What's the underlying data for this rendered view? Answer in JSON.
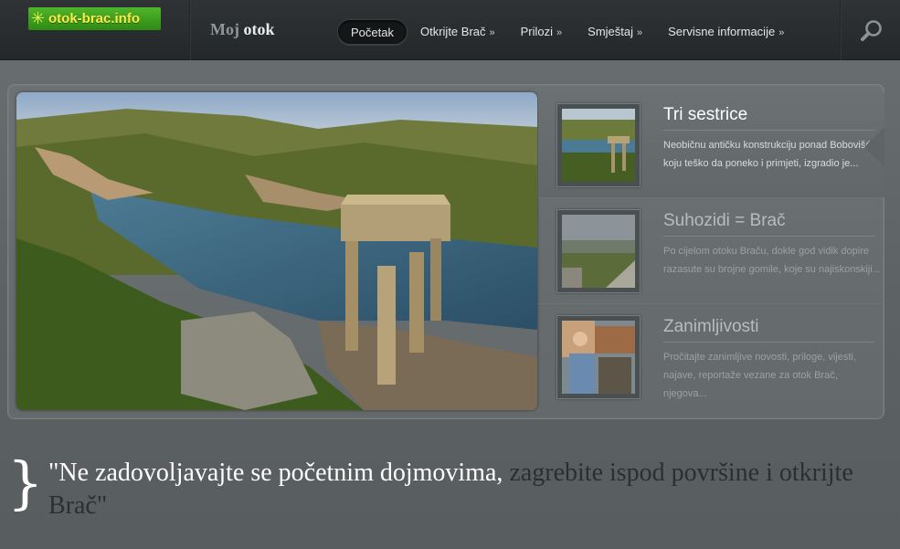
{
  "header": {
    "logo_text": "otok-brac.info",
    "site_title_part1": "Moj",
    "site_title_part2": "otok",
    "nav": [
      {
        "label": "Početak",
        "active": true
      },
      {
        "label": "Otkrijte Brač",
        "chevron": "»"
      },
      {
        "label": "Prilozi",
        "chevron": "»"
      },
      {
        "label": "Smještaj",
        "chevron": "»"
      },
      {
        "label": "Servisne informacije",
        "chevron": "»"
      }
    ],
    "search_icon": "magnifier-icon"
  },
  "slider": {
    "items": [
      {
        "title": "Tri sestrice",
        "description": "Neobičnu antičku konstrukciju ponad Bobovišća, koju teško da poneko i primjeti, izgradio je...",
        "active": true
      },
      {
        "title": "Suhozidi = Brač",
        "description": "Po cijelom otoku Braču, dokle god vidik dopire razasute su brojne gomile, koje su najiskonskiji..."
      },
      {
        "title": "Zanimljivosti",
        "description": "Pročitajte zanimljive novosti, priloge, vijesti, najave, reportaže vezane za otok Brač, njegova..."
      }
    ]
  },
  "quote": {
    "brace": "}",
    "part1": "\"Ne zadovoljavajte se početnim dojmovima,",
    "part2": " zagrebite ispod površine i otkrijte Brač\""
  },
  "colors": {
    "header_bg": "#2a2e30",
    "page_bg": "#5f6466",
    "logo_green": "#3a9a1e",
    "logo_text": "#ffe94a"
  }
}
